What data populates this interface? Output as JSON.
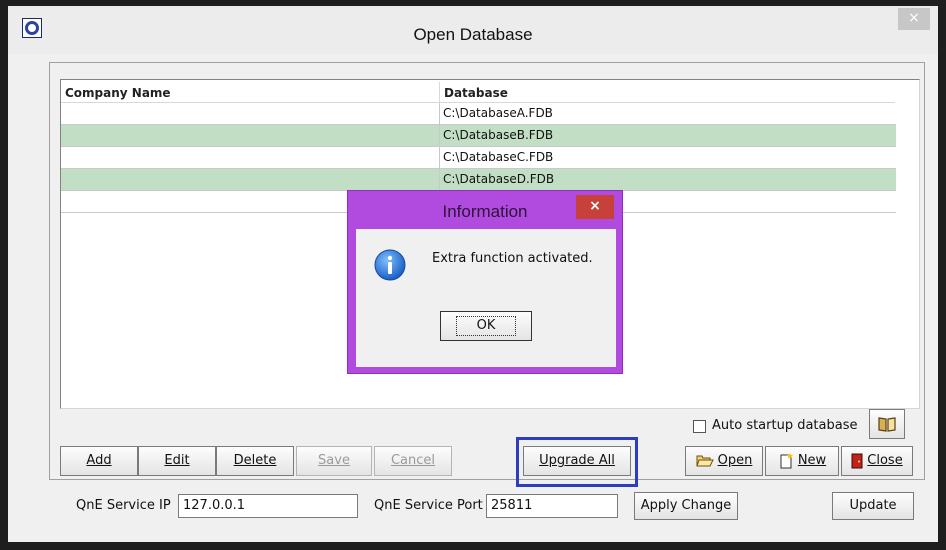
{
  "window": {
    "title": "Open Database",
    "close_glyph": "×",
    "icon": "qne-logo-icon"
  },
  "table": {
    "columns": [
      "Company Name",
      "Database"
    ],
    "rows": [
      {
        "company": "",
        "database": "C:\\DatabaseA.FDB"
      },
      {
        "company": "",
        "database": "C:\\DatabaseB.FDB"
      },
      {
        "company": "",
        "database": "C:\\DatabaseC.FDB"
      },
      {
        "company": "",
        "database": "C:\\DatabaseD.FDB"
      },
      {
        "company": "",
        "database": ""
      }
    ],
    "alt_row_color": "#c2dfc5"
  },
  "auto_startup": {
    "label": "Auto startup database",
    "checked": false
  },
  "buttons": {
    "add": "Add",
    "edit": "Edit",
    "delete": "Delete",
    "save": "Save",
    "cancel": "Cancel",
    "upgrade_all": "Upgrade All",
    "open": "Open",
    "new": "New",
    "close": "Close",
    "apply_change": "Apply Change",
    "update": "Update"
  },
  "service": {
    "ip_label": "QnE Service IP",
    "ip_value": "127.0.0.1",
    "port_label": "QnE Service Port",
    "port_value": "25811"
  },
  "dialog": {
    "title": "Information",
    "close_glyph": "×",
    "message": "Extra function activated.",
    "ok_label": "OK",
    "icon": "info-icon",
    "accent": "#b14be0"
  },
  "highlight_color": "#2d3dbf"
}
